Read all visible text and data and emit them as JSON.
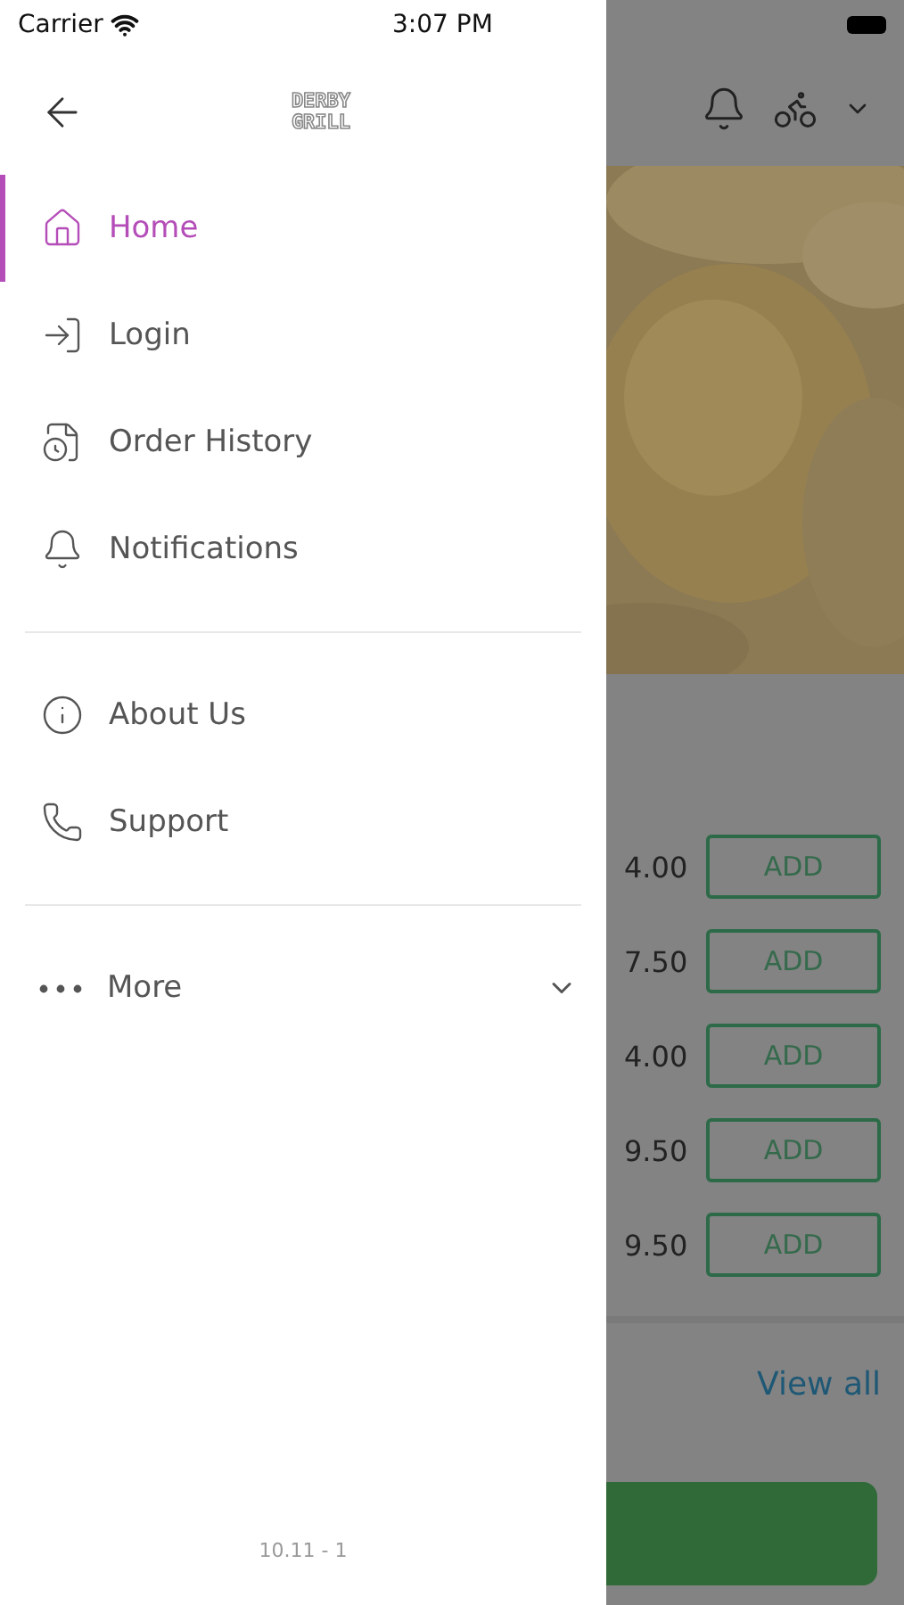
{
  "status_bar": {
    "carrier": "Carrier",
    "time": "3:07 PM"
  },
  "drawer": {
    "logo": "DERBY GRILL",
    "sections": [
      {
        "items": [
          {
            "label": "Home",
            "kind": "home",
            "selected": true
          },
          {
            "label": "Login",
            "kind": "login",
            "selected": false
          },
          {
            "label": "Order History",
            "kind": "history",
            "selected": false
          },
          {
            "label": "Notifications",
            "kind": "bell",
            "selected": false
          }
        ]
      },
      {
        "items": [
          {
            "label": "About Us",
            "kind": "info",
            "selected": false
          },
          {
            "label": "Support",
            "kind": "phone",
            "selected": false
          }
        ]
      }
    ],
    "more": {
      "label": "More",
      "expanded": false
    },
    "version": "10.11 - 1"
  },
  "background": {
    "prices": [
      {
        "price": "4.00",
        "button": "ADD"
      },
      {
        "price": "7.50",
        "button": "ADD"
      },
      {
        "price": "4.00",
        "button": "ADD"
      },
      {
        "price": "9.50",
        "button": "ADD"
      },
      {
        "price": "9.50",
        "button": "ADD"
      }
    ],
    "link": "View all"
  }
}
